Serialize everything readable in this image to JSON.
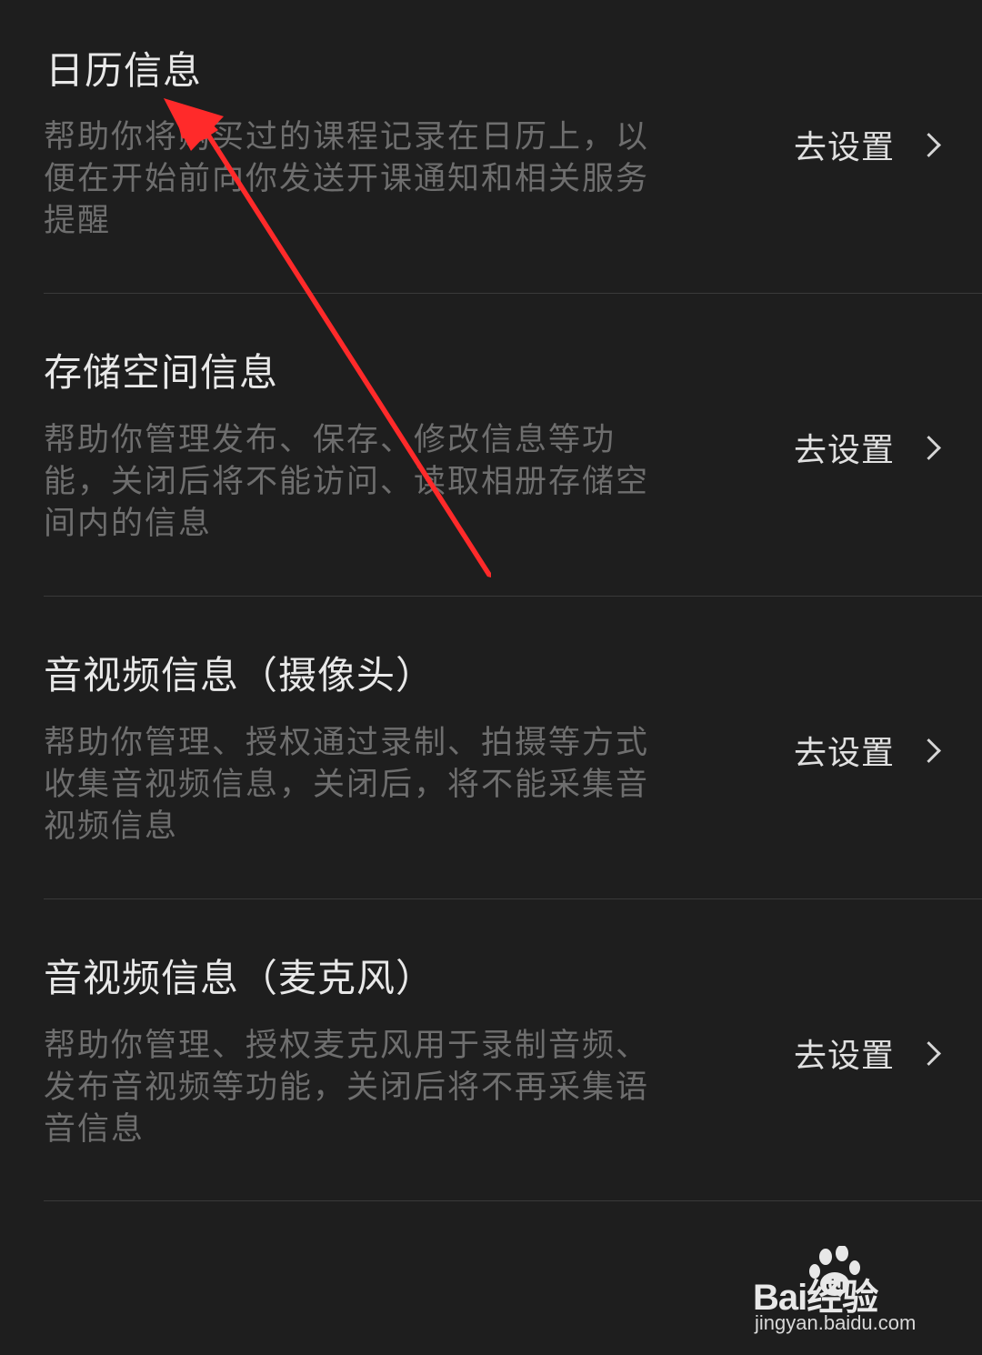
{
  "items": [
    {
      "title": "日历信息",
      "description": "帮助你将购买过的课程记录在日历上，以\n便在开始前向你发送开课通知和相关服务\n提醒",
      "action_label": "去设置"
    },
    {
      "title": "存储空间信息",
      "description": "帮助你管理发布、保存、修改信息等功\n能，关闭后将不能访问、读取相册存储空\n间内的信息",
      "action_label": "去设置"
    },
    {
      "title": "音视频信息（摄像头）",
      "description": "帮助你管理、授权通过录制、拍摄等方式\n收集音视频信息，关闭后，将不能采集音\n视频信息",
      "action_label": "去设置"
    },
    {
      "title": "音视频信息（麦克风）",
      "description": "帮助你管理、授权麦克风用于录制音频、\n发布音视频等功能，关闭后将不再采集语\n音信息",
      "action_label": "去设置"
    }
  ],
  "watermark": {
    "logo_text": "Bai经验",
    "url": "jingyan.baidu.com"
  },
  "colors": {
    "background": "#1e1e1e",
    "title": "#e8e8e8",
    "description": "#6e6e6e",
    "divider": "#3a3a3a",
    "annotation_arrow": "#ff2a2a"
  },
  "icons": {
    "chevron": "chevron-right-icon",
    "watermark_logo": "baidu-paw-icon"
  }
}
